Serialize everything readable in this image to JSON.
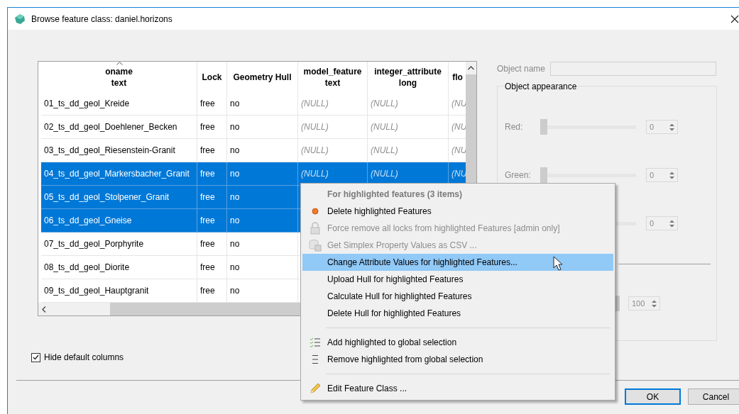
{
  "window": {
    "title": "Browse feature class: daniel.horizons"
  },
  "table": {
    "columns": [
      {
        "label": "oname",
        "sublabel": "text",
        "kind": "fixed",
        "sorted": true
      },
      {
        "label": "Lock",
        "kind": "fixed",
        "sorted": false
      },
      {
        "label": "Geometry Hull",
        "kind": "fixed",
        "sorted": false
      },
      {
        "label": "model_feature",
        "sublabel": "text",
        "kind": "attribute",
        "sorted": false
      },
      {
        "label": "integer_attribute",
        "sublabel": "long",
        "kind": "attribute",
        "sorted": false
      },
      {
        "label": "flo",
        "kind": "attribute",
        "sorted": false
      }
    ],
    "rows": [
      {
        "cells": [
          "01_ts_dd_geol_Kreide",
          "free",
          "no",
          "(NULL)",
          "(NULL)",
          "(NU"
        ],
        "selected": false
      },
      {
        "cells": [
          "02_ts_dd_geol_Doehlener_Becken",
          "free",
          "no",
          "(NULL)",
          "(NULL)",
          "(NU"
        ],
        "selected": false
      },
      {
        "cells": [
          "03_ts_dd_geol_Riesenstein-Granit",
          "free",
          "no",
          "(NULL)",
          "(NULL)",
          "(NU"
        ],
        "selected": false
      },
      {
        "cells": [
          "04_ts_dd_geol_Markersbacher_Granit",
          "free",
          "no",
          "(NULL)",
          "(NULL)",
          "(NU"
        ],
        "selected": true
      },
      {
        "cells": [
          "05_ts_dd_geol_Stolpener_Granit",
          "free",
          "no"
        ],
        "selected": true
      },
      {
        "cells": [
          "06_ts_dd_geol_Gneise",
          "free",
          "no"
        ],
        "selected": true
      },
      {
        "cells": [
          "07_ts_dd_geol_Porphyrite",
          "free",
          "no"
        ],
        "selected": false
      },
      {
        "cells": [
          "08_ts_dd_geol_Diorite",
          "free",
          "no"
        ],
        "selected": false
      },
      {
        "cells": [
          "09_ts_dd_geol_Hauptgranit",
          "free",
          "no"
        ],
        "selected": false
      }
    ]
  },
  "properties": {
    "disabled": true,
    "object_name": {
      "label": "Object name"
    },
    "appearance": {
      "title": "Object appearance",
      "sliders": [
        {
          "label": "Red:",
          "value": "0",
          "level": 0
        },
        {
          "label": "Green:",
          "value": "0",
          "level": 0
        },
        {
          "value": "0",
          "level": 0
        },
        {
          "value": "100",
          "level": 1,
          "kind": "opacity"
        }
      ]
    }
  },
  "hide_default_columns": {
    "label": "Hide default columns",
    "checked": true
  },
  "buttons": [
    {
      "label": "OK",
      "default": true
    },
    {
      "label": "Cancel",
      "default": false
    }
  ],
  "context_menu": {
    "items": [
      {
        "kind": "header",
        "label": "For highlighted features (3 items)"
      },
      {
        "kind": "delete",
        "label": "Delete highlighted Features",
        "disabled": false,
        "selected": false
      },
      {
        "kind": "unlock",
        "label": "Force remove all locks from highlighted Features [admin only]",
        "disabled": true,
        "selected": false
      },
      {
        "kind": "export",
        "label": "Get Simplex Property Values as CSV ...",
        "disabled": true,
        "selected": false
      },
      {
        "kind": "item",
        "label": "Change Attribute Values for highlighted Features...",
        "disabled": false,
        "selected": true
      },
      {
        "kind": "item",
        "label": "Upload Hull for highlighted Features",
        "disabled": false,
        "selected": false
      },
      {
        "kind": "item",
        "label": "Calculate Hull for highlighted Features",
        "disabled": false,
        "selected": false
      },
      {
        "kind": "item",
        "label": "Delete Hull for highlighted Features",
        "disabled": false,
        "selected": false
      },
      {
        "kind": "separator"
      },
      {
        "kind": "add",
        "label": "Add highlighted to global selection",
        "disabled": false,
        "selected": false
      },
      {
        "kind": "remove",
        "label": "Remove highlighted from global selection",
        "disabled": false,
        "selected": false
      },
      {
        "kind": "separator"
      },
      {
        "kind": "edit",
        "label": "Edit Feature Class ...",
        "disabled": false,
        "selected": false
      }
    ]
  }
}
